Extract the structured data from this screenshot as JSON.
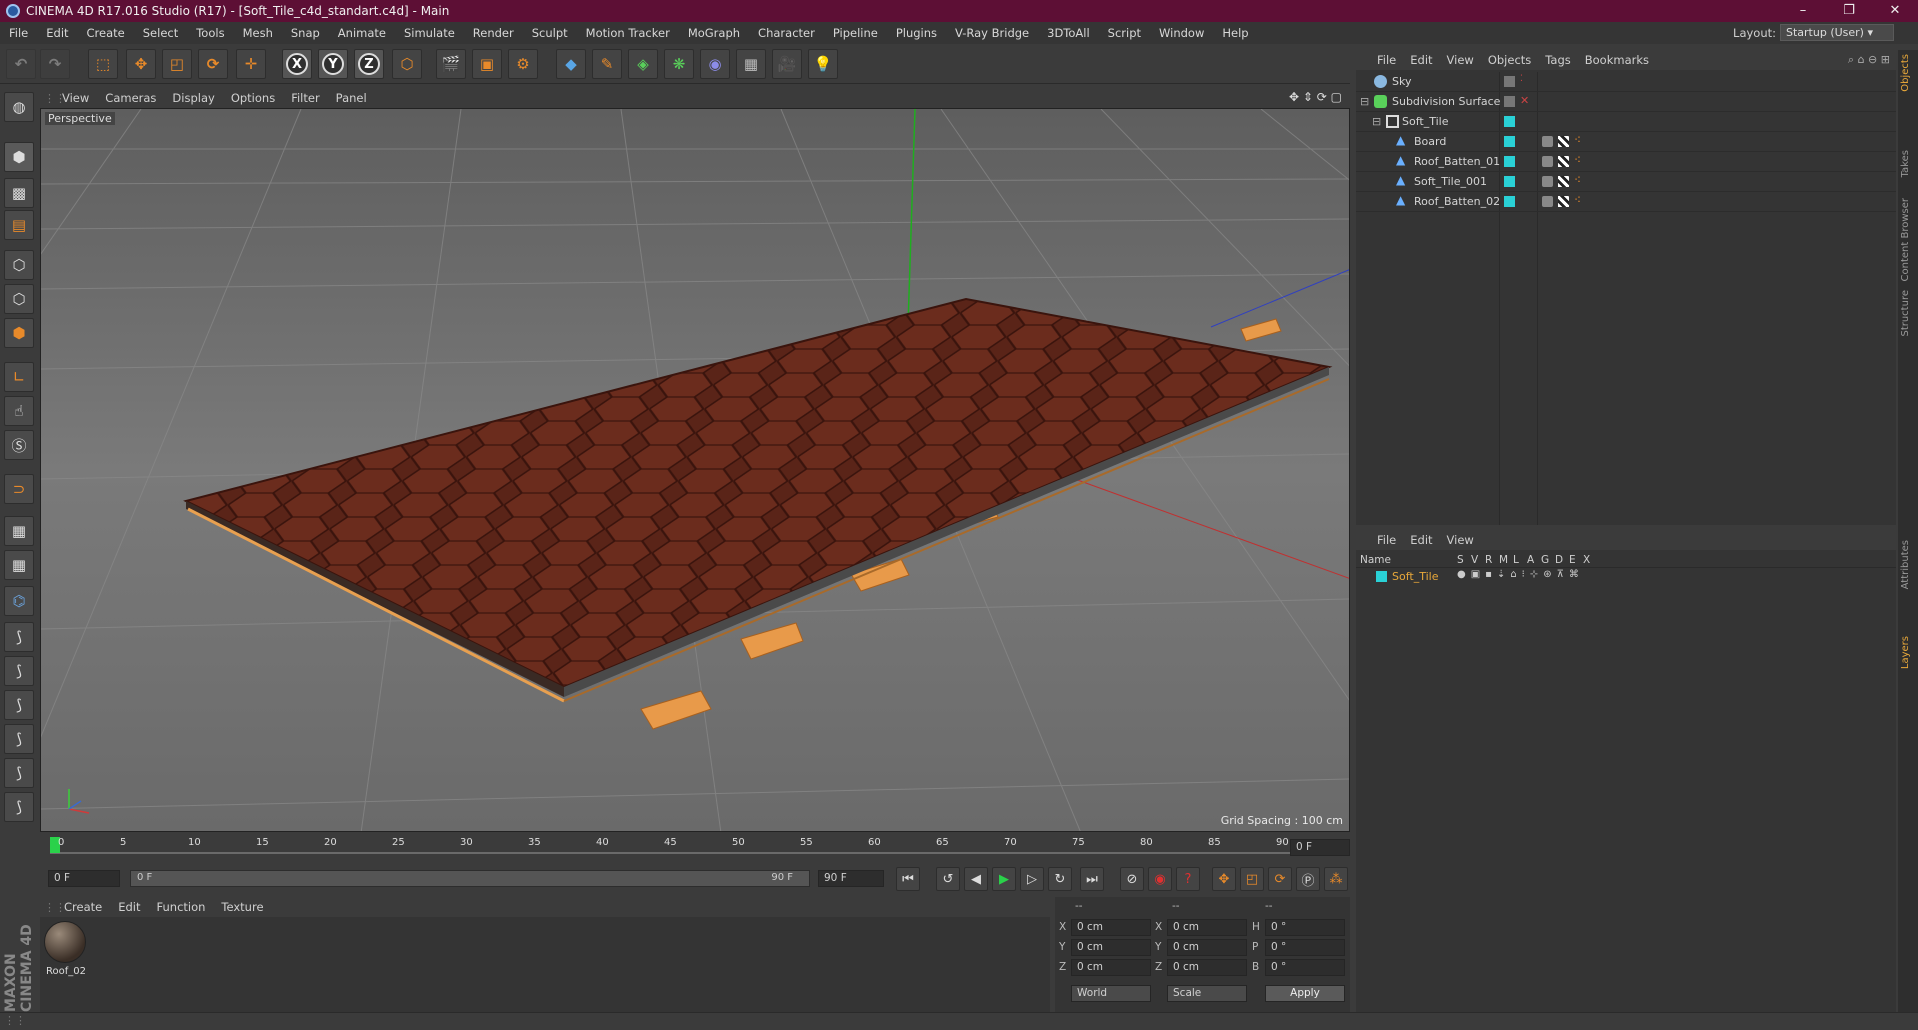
{
  "window": {
    "title": "CINEMA 4D R17.016 Studio (R17) - [Soft_Tile_c4d_standart.c4d] - Main",
    "minimize": "–",
    "maximize": "❐",
    "close": "✕"
  },
  "menubar": {
    "items": [
      "File",
      "Edit",
      "Create",
      "Select",
      "Tools",
      "Mesh",
      "Snap",
      "Animate",
      "Simulate",
      "Render",
      "Sculpt",
      "Motion Tracker",
      "MoGraph",
      "Character",
      "Pipeline",
      "Plugins",
      "V-Ray Bridge",
      "3DToAll",
      "Script",
      "Window",
      "Help"
    ],
    "layout_label": "Layout:",
    "layout_value": "Startup (User)"
  },
  "toolbar": {
    "axis_x": "X",
    "axis_y": "Y",
    "axis_z": "Z"
  },
  "viewport": {
    "menu": [
      "View",
      "Cameras",
      "Display",
      "Options",
      "Filter",
      "Panel"
    ],
    "camera_label": "Perspective",
    "grid_spacing": "Grid Spacing : 100 cm"
  },
  "timeline": {
    "ticks": [
      "0",
      "5",
      "10",
      "15",
      "20",
      "25",
      "30",
      "35",
      "40",
      "45",
      "50",
      "55",
      "60",
      "65",
      "70",
      "75",
      "80",
      "85",
      "90"
    ],
    "current_frame": "0 F"
  },
  "frames": {
    "start": "0 F",
    "range_start": "0 F",
    "range_end": "90 F",
    "end": "90 F"
  },
  "material_manager": {
    "menu": [
      "Create",
      "Edit",
      "Function",
      "Texture"
    ],
    "materials": [
      {
        "name": "Roof_02"
      }
    ]
  },
  "coordinates": {
    "col_headers": [
      "--",
      "--",
      "--"
    ],
    "rows": [
      {
        "a_lbl": "X",
        "a_val": "0 cm",
        "b_lbl": "X",
        "b_val": "0 cm",
        "c_lbl": "H",
        "c_val": "0 °"
      },
      {
        "a_lbl": "Y",
        "a_val": "0 cm",
        "b_lbl": "Y",
        "b_val": "0 cm",
        "c_lbl": "P",
        "c_val": "0 °"
      },
      {
        "a_lbl": "Z",
        "a_val": "0 cm",
        "b_lbl": "Z",
        "b_val": "0 cm",
        "c_lbl": "B",
        "c_val": "0 °"
      }
    ],
    "world": "World",
    "scale": "Scale",
    "apply": "Apply"
  },
  "object_manager": {
    "menu": [
      "File",
      "Edit",
      "View",
      "Objects",
      "Tags",
      "Bookmarks"
    ],
    "objects": [
      {
        "name": "Sky",
        "indent": 0
      },
      {
        "name": "Subdivision Surface",
        "indent": 0
      },
      {
        "name": "Soft_Tile",
        "indent": 1
      },
      {
        "name": "Board",
        "indent": 2
      },
      {
        "name": "Roof_Batten_01",
        "indent": 2
      },
      {
        "name": "Soft_Tile_001",
        "indent": 2
      },
      {
        "name": "Roof_Batten_02",
        "indent": 2
      }
    ]
  },
  "layer_manager": {
    "menu": [
      "File",
      "Edit",
      "View"
    ],
    "columns": [
      "Name",
      "S",
      "V",
      "R",
      "M",
      "L",
      "A",
      "G",
      "D",
      "E",
      "X"
    ],
    "layers": [
      {
        "name": "Soft_Tile",
        "color": "#2ad1d6"
      }
    ]
  },
  "right_tabs": [
    "Objects",
    "Takes",
    "Content Browser",
    "Structure",
    "Attributes",
    "Layers"
  ],
  "side_logo": "MAXON CINEMA 4D",
  "colors": {
    "titlebar": "#5d0f35",
    "accent_orange": "#e88a2a",
    "layer_cyan": "#2ad1d6",
    "tile_brown": "#5a2418"
  }
}
